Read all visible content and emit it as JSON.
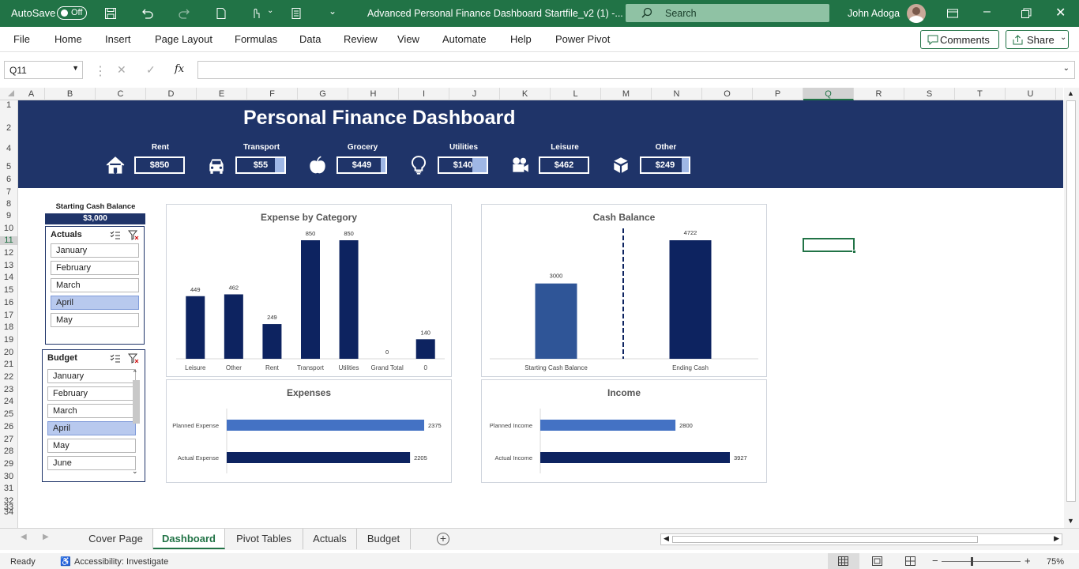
{
  "titlebar": {
    "autosave_label": "AutoSave",
    "autosave_state": "Off",
    "doc_title": "Advanced Personal Finance Dashboard Startfile_v2 (1)  -...",
    "search_placeholder": "Search",
    "user_name": "John Adoga"
  },
  "ribbon": {
    "tabs": [
      "File",
      "Home",
      "Insert",
      "Page Layout",
      "Formulas",
      "Data",
      "Review",
      "View",
      "Automate",
      "Help",
      "Power Pivot"
    ],
    "comments_label": "Comments",
    "share_label": "Share"
  },
  "formula_bar": {
    "name_box": "Q11",
    "fx": "fx",
    "formula": ""
  },
  "columns": [
    "A",
    "B",
    "C",
    "D",
    "E",
    "F",
    "G",
    "H",
    "I",
    "J",
    "K",
    "L",
    "M",
    "N",
    "O",
    "P",
    "Q",
    "R",
    "S",
    "T",
    "U"
  ],
  "rows": [
    "1",
    "2",
    "4",
    "5",
    "6",
    "7",
    "8",
    "9",
    "10",
    "11",
    "12",
    "13",
    "14",
    "15",
    "16",
    "17",
    "18",
    "19",
    "20",
    "21",
    "22",
    "23",
    "24",
    "25",
    "26",
    "27",
    "28",
    "29",
    "30",
    "31",
    "32",
    "33",
    "34"
  ],
  "dashboard": {
    "title": "Personal Finance Dashboard",
    "kpis": [
      {
        "label": "Rent",
        "value": "$850",
        "fill": 0,
        "icon": "house-icon"
      },
      {
        "label": "Transport",
        "value": "$55",
        "fill": 0.2,
        "icon": "car-icon"
      },
      {
        "label": "Grocery",
        "value": "$449",
        "fill": 0.1,
        "icon": "apple-icon"
      },
      {
        "label": "Utilities",
        "value": "$140",
        "fill": 0.3,
        "icon": "lightbulb-icon"
      },
      {
        "label": "Leisure",
        "value": "$462",
        "fill": 0,
        "icon": "camera-icon"
      },
      {
        "label": "Other",
        "value": "$249",
        "fill": 0.15,
        "icon": "boxes-icon"
      }
    ],
    "starting_cash_label": "Starting Cash Balance",
    "starting_cash_value": "$3,000",
    "actuals_slicer": {
      "title": "Actuals",
      "items": [
        "January",
        "February",
        "March",
        "April",
        "May"
      ],
      "selected": "April"
    },
    "budget_slicer": {
      "title": "Budget",
      "items": [
        "January",
        "February",
        "March",
        "April",
        "May",
        "June"
      ],
      "selected": "April"
    }
  },
  "chart_data": [
    {
      "type": "bar",
      "title": "Expense by Category",
      "categories": [
        "Leisure",
        "Other",
        "Rent",
        "Transport",
        "Utilities",
        "Grand Total",
        "0"
      ],
      "values": [
        449,
        462,
        249,
        850,
        850,
        0,
        140
      ],
      "data_labels": [
        "449",
        "462",
        "249",
        "850",
        "850",
        "0",
        "140"
      ],
      "color": "#0d2360"
    },
    {
      "type": "bar",
      "title": "Cash Balance",
      "categories": [
        "Starting Cash Balance",
        "Ending Cash"
      ],
      "values": [
        3000,
        4722
      ],
      "data_labels": [
        "3000",
        "4722"
      ],
      "colors": [
        "#2f5597",
        "#0d2360"
      ]
    },
    {
      "type": "bar",
      "orientation": "horizontal",
      "title": "Expenses",
      "categories": [
        "Planned Expense",
        "Actual Expense"
      ],
      "values": [
        2375,
        2205
      ],
      "data_labels": [
        "2375",
        "2205"
      ],
      "colors": [
        "#4472c4",
        "#0d2360"
      ]
    },
    {
      "type": "bar",
      "orientation": "horizontal",
      "title": "Income",
      "categories": [
        "Planned Income",
        "Actual Income"
      ],
      "values": [
        2800,
        3927
      ],
      "data_labels": [
        "2800",
        "3927"
      ],
      "colors": [
        "#4472c4",
        "#0d2360"
      ]
    }
  ],
  "sheet_tabs": [
    "Cover Page",
    "Dashboard",
    "Pivot Tables",
    "Actuals",
    "Budget"
  ],
  "active_tab": "Dashboard",
  "status": {
    "ready": "Ready",
    "accessibility": "Accessibility: Investigate",
    "zoom": "75%"
  },
  "colors": {
    "excel_green": "#217346",
    "banner": "#1f3469",
    "bar_dark": "#0d2360",
    "bar_mid": "#2f5597",
    "bar_light": "#4472c4"
  }
}
